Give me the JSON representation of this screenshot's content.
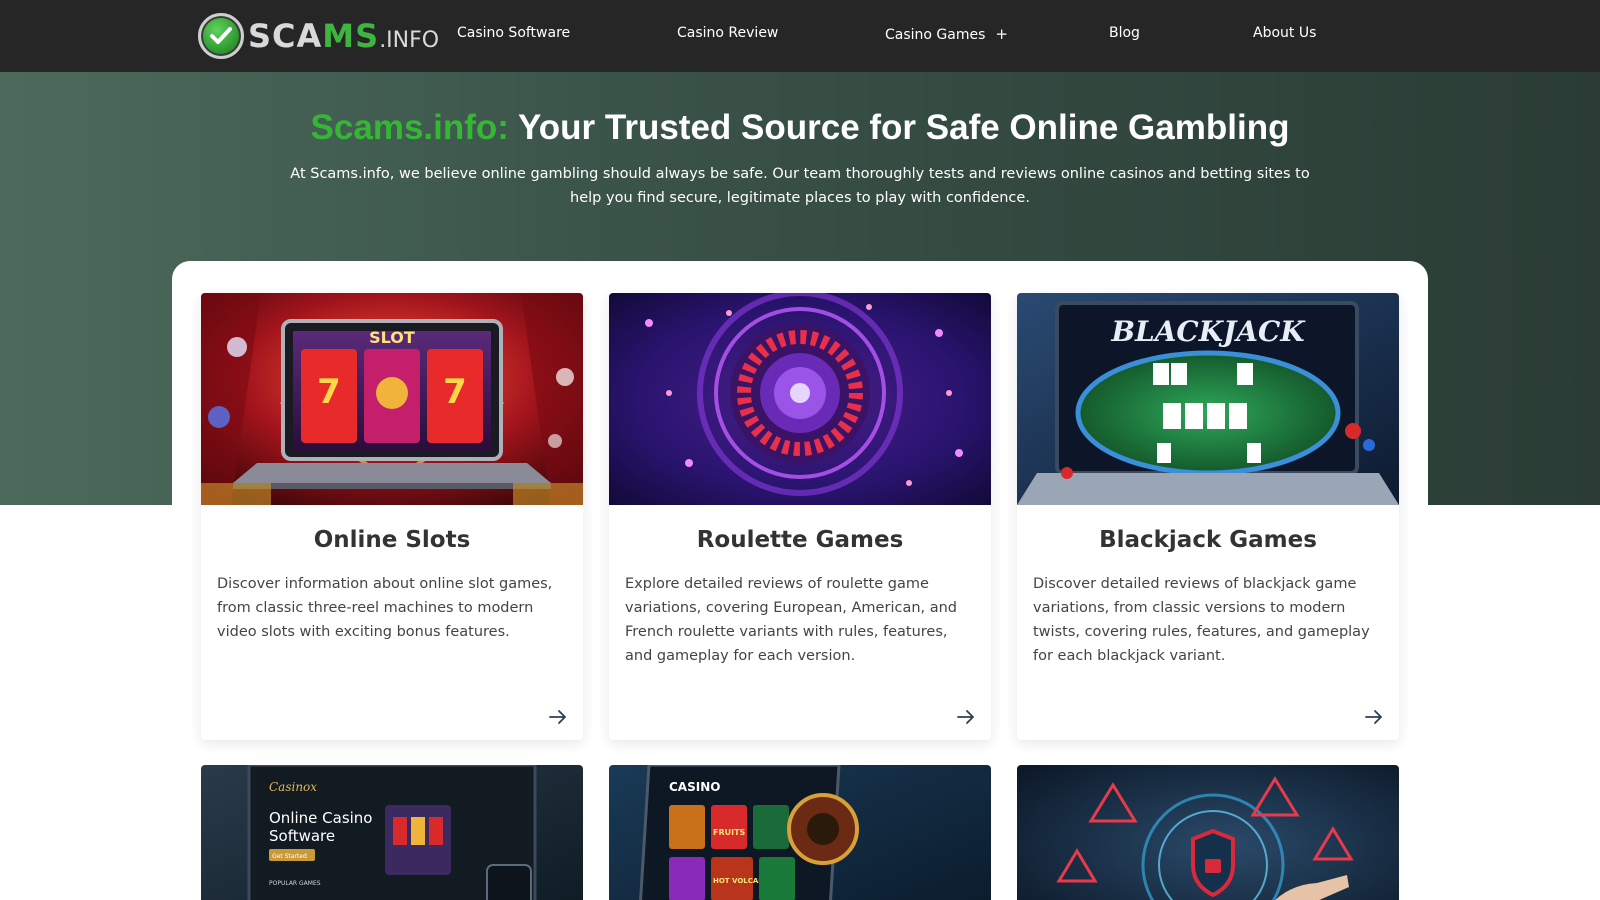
{
  "header": {
    "logo_text_1": "SCA",
    "logo_text_2": "MS",
    "logo_text_3": ".INFO",
    "nav": [
      {
        "label": "Casino Software"
      },
      {
        "label": "Casino Review"
      },
      {
        "label": "Casino Games",
        "expand": "+"
      },
      {
        "label": "Blog"
      },
      {
        "label": "About Us"
      }
    ]
  },
  "hero": {
    "title_brand": "Scams.info:",
    "title_rest": " Your Trusted Source for Safe Online Gambling",
    "description": "At Scams.info, we believe online gambling should always be safe. Our team thoroughly tests and reviews online casinos and betting sites to help you find secure, legitimate places to play with confidence."
  },
  "cards": [
    {
      "title": "Online Slots",
      "text": "Discover information about online slot games, from classic three-reel machines to modern video slots with exciting bonus features.",
      "image_label": "SLOT"
    },
    {
      "title": "Roulette Games",
      "text": "Explore detailed reviews of roulette game variations, covering European, American, and French roulette variants with rules, features, and gameplay for each version."
    },
    {
      "title": "Blackjack Games",
      "text": "Discover detailed reviews of blackjack game variations, from classic versions to modern twists, covering rules, features, and gameplay for each blackjack variant.",
      "image_label": "BLACKJACK"
    }
  ],
  "cards_row2": [
    {
      "image_brand": "Casinox",
      "image_heading_1": "Online Casino",
      "image_heading_2": "Software",
      "image_button": "Get Started",
      "image_section": "POPULAR GAMES"
    },
    {
      "image_brand": "CASINO",
      "image_tile_1": "FRUITS",
      "image_tile_2": "HOT VOLCANO"
    },
    {}
  ],
  "colors": {
    "header_bg": "#262626",
    "brand_green": "#35b735",
    "hero_start": "#4c6a5c",
    "hero_end": "#2a3c35"
  }
}
